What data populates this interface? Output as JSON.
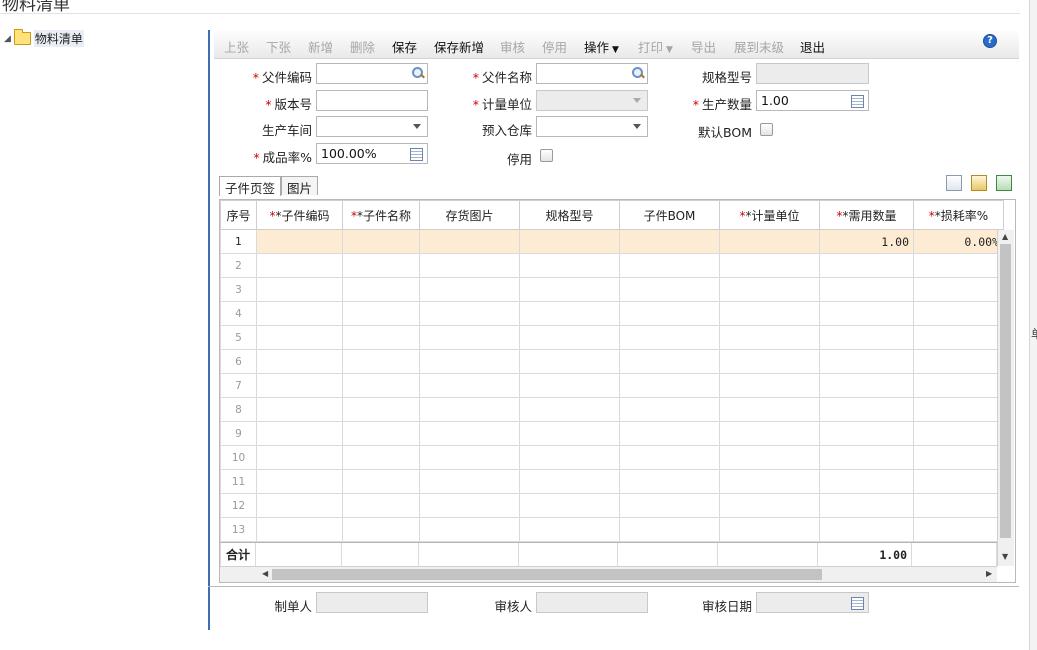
{
  "page": {
    "title": "物料清单"
  },
  "tree": {
    "label": "物料清单"
  },
  "right_strip": {
    "mark": "单"
  },
  "toolbar": {
    "buttons": [
      {
        "label": "上张",
        "state": "disabled"
      },
      {
        "label": "下张",
        "state": "disabled"
      },
      {
        "label": "新增",
        "state": "disabled"
      },
      {
        "label": "删除",
        "state": "disabled"
      },
      {
        "label": "保存",
        "state": "enabled"
      },
      {
        "label": "保存新增",
        "state": "enabled"
      },
      {
        "label": "审核",
        "state": "disabled"
      },
      {
        "label": "停用",
        "state": "disabled"
      },
      {
        "label": "操作",
        "state": "enabled",
        "dropdown": true
      },
      {
        "label": "打印",
        "state": "disabled",
        "dropdown": true
      },
      {
        "label": "导出",
        "state": "disabled"
      },
      {
        "label": "展到末级",
        "state": "disabled"
      },
      {
        "label": "退出",
        "state": "enabled"
      }
    ],
    "help": "?"
  },
  "form": {
    "parent_code": {
      "label": "父件编码",
      "value": ""
    },
    "parent_name": {
      "label": "父件名称",
      "value": ""
    },
    "spec": {
      "label": "规格型号",
      "value": ""
    },
    "version": {
      "label": "版本号",
      "value": ""
    },
    "unit": {
      "label": "计量单位",
      "value": ""
    },
    "qty": {
      "label": "生产数量",
      "value": "1.00"
    },
    "workshop": {
      "label": "生产车间",
      "value": ""
    },
    "warehouse": {
      "label": "预入仓库",
      "value": ""
    },
    "default_bom": {
      "label": "默认BOM",
      "checked": false
    },
    "yield": {
      "label": "成品率%",
      "value": "100.00%"
    },
    "disabled": {
      "label": "停用",
      "checked": false
    }
  },
  "tabs": [
    {
      "label": "子件页签"
    },
    {
      "label": "图片"
    }
  ],
  "grid": {
    "columns": [
      "序号",
      "*子件编码",
      "*子件名称",
      "存货图片",
      "规格型号",
      "子件BOM",
      "*计量单位",
      "*需用数量",
      "*损耗率%"
    ],
    "rows": [
      {
        "seq": "1",
        "qty": "1.00",
        "loss": "0.00%"
      },
      {
        "seq": "2"
      },
      {
        "seq": "3"
      },
      {
        "seq": "4"
      },
      {
        "seq": "5"
      },
      {
        "seq": "6"
      },
      {
        "seq": "7"
      },
      {
        "seq": "8"
      },
      {
        "seq": "9"
      },
      {
        "seq": "10"
      },
      {
        "seq": "11"
      },
      {
        "seq": "12"
      },
      {
        "seq": "13"
      }
    ],
    "total_label": "合计",
    "total_qty": "1.00"
  },
  "footer": {
    "creator": {
      "label": "制单人",
      "value": ""
    },
    "auditor": {
      "label": "审核人",
      "value": ""
    },
    "audit_date": {
      "label": "审核日期",
      "value": ""
    }
  }
}
